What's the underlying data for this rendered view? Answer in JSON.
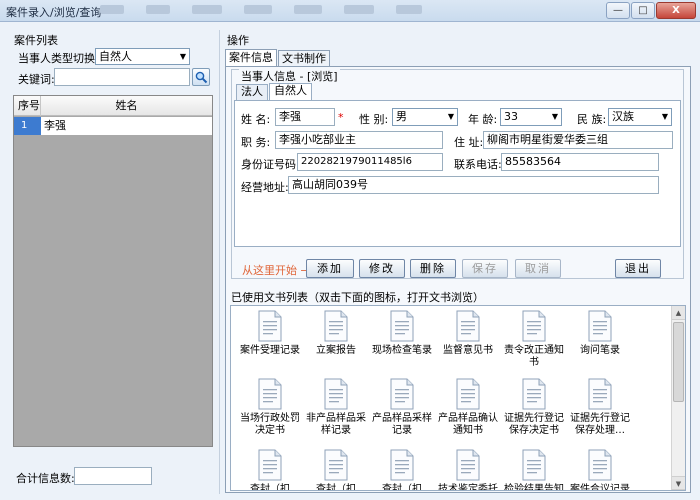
{
  "window": {
    "title": "案件录入/浏览/查询",
    "buttons": {
      "minimize": "—",
      "maximize": "□",
      "close": "X"
    }
  },
  "left": {
    "section_title": "案件列表",
    "type_switch_label": "当事人类型切换:",
    "type_switch_value": "自然人",
    "keyword_label": "关键词:",
    "keyword_value": "",
    "table": {
      "columns": [
        "序号",
        "姓名"
      ],
      "rows": [
        {
          "index": "1",
          "name": "李强"
        }
      ]
    },
    "count_label": "合计信息数:",
    "count_value": ""
  },
  "right": {
    "section_title": "操作",
    "tabs": [
      "案件信息",
      "文书制作"
    ],
    "party_info_title": "当事人信息 - [浏览]",
    "party_tabs": [
      "法人",
      "自然人"
    ],
    "form": {
      "name_label": "姓 名:",
      "name_value": "李强",
      "required_mark": "*",
      "gender_label": "性 别:",
      "gender_value": "男",
      "age_label": "年 龄:",
      "age_value": "33",
      "ethnicity_label": "民 族:",
      "ethnicity_value": "汉族",
      "job_label": "职 务:",
      "job_value": "李强小吃部业主",
      "address_label": "住 址:",
      "address_value": "柳阁市明星街爱华委三组",
      "id_label": "身份证号码:",
      "id_value": "2202821979011485l6",
      "phone_label": "联系电话:",
      "phone_value": "85583564",
      "business_address_label": "经营地址:",
      "business_address_value": "高山胡同039号"
    },
    "actions": {
      "hint": "从这里开始 →",
      "add": "添加",
      "edit": "修改",
      "delete": "删除",
      "save": "保存",
      "cancel": "取消",
      "exit": "退出"
    },
    "doclist_label": "已使用文书列表（双击下面的图标，打开文书浏览）",
    "documents": [
      "案件受理记录",
      "立案报告",
      "现场检查笔录",
      "监督意见书",
      "责令改正通知书",
      "询问笔录",
      "当场行政处罚决定书",
      "非产品样品采样记录",
      "产品样品采样记录",
      "产品样品确认通知书",
      "证据先行登记保存决定书",
      "证据先行登记保存处理…",
      "查封（扣押）…",
      "查封（扣押）…",
      "查封（扣押）…",
      "技术鉴定委托书",
      "检验结果告知书",
      "案件合议记录"
    ]
  }
}
